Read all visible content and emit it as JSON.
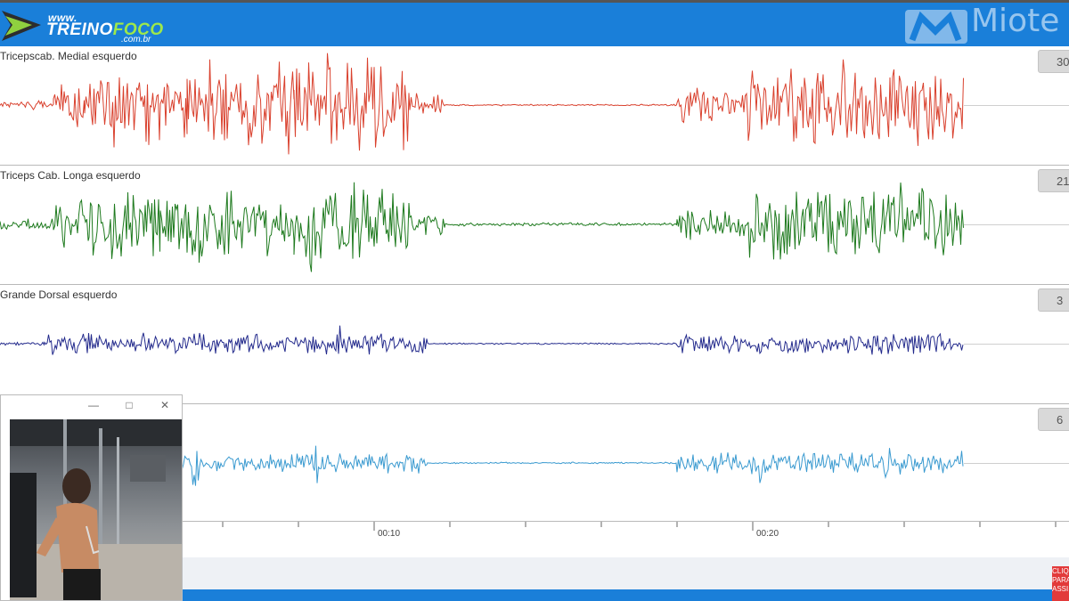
{
  "brand": {
    "site": "www.",
    "name_part1": "TREINO",
    "name_part2": "FOCO",
    "tld": ".com.br"
  },
  "app_logo": {
    "text": "Miote"
  },
  "colors": {
    "header_bg": "#1a7fd9",
    "channel1": "#d9412e",
    "channel2": "#1e7a1e",
    "channel3": "#232a8c",
    "channel4": "#3a9ad0"
  },
  "channels": [
    {
      "label": "Tricepscab. Medial esquerdo",
      "scale": "30",
      "color": "#d9412e"
    },
    {
      "label": "Triceps Cab. Longa esquerdo",
      "scale": "21",
      "color": "#1e7a1e"
    },
    {
      "label": "Grande Dorsal esquerdo",
      "scale": "3",
      "color": "#232a8c"
    },
    {
      "label": "",
      "scale": "6",
      "color": "#3a9ad0"
    }
  ],
  "timeline": {
    "labels": [
      "00:10",
      "00:20"
    ]
  },
  "video_window": {
    "minimize_icon": "minimize-icon",
    "maximize_icon": "maximize-icon",
    "close_icon": "close-icon"
  },
  "cta": {
    "text": "CLIQ PARA ASSI"
  }
}
